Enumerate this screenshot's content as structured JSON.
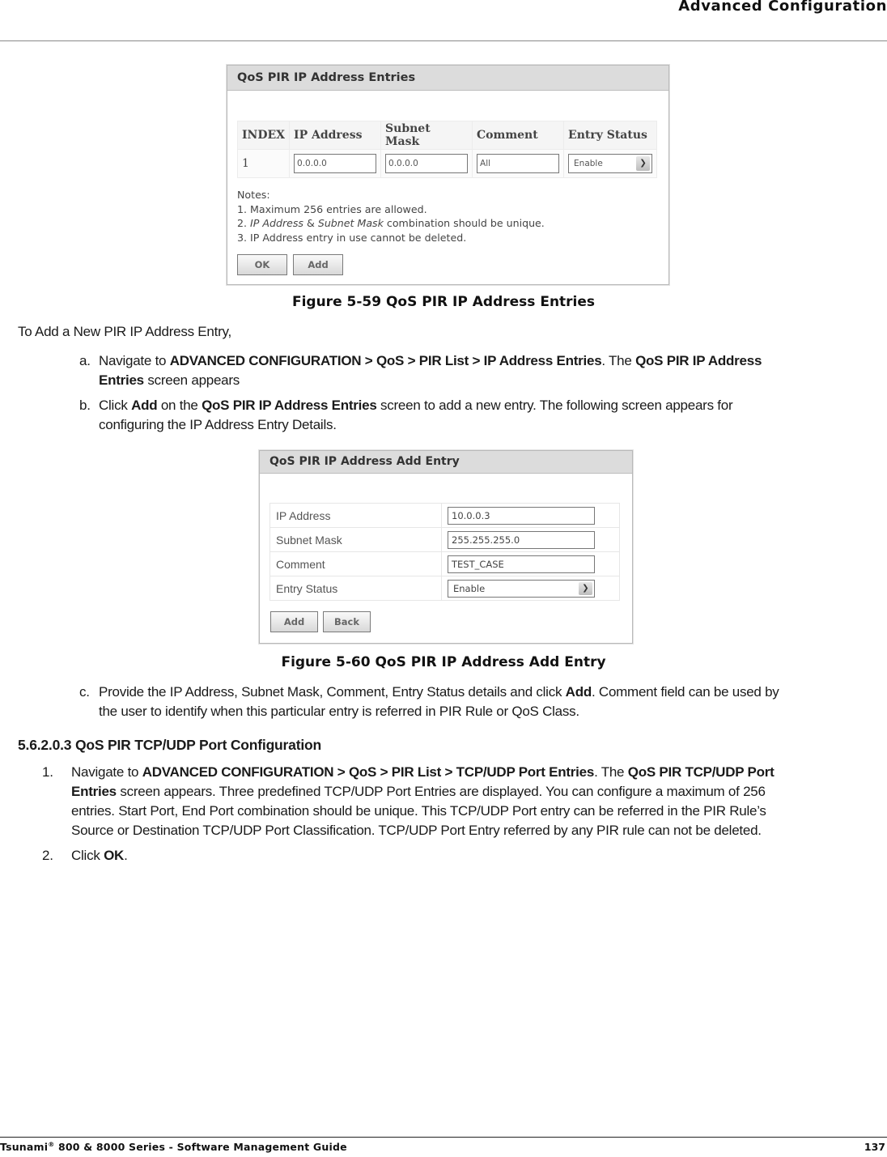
{
  "header": {
    "title": "Advanced Configuration"
  },
  "figure1": {
    "panel_title": "QoS PIR IP Address Entries",
    "columns": [
      "INDEX",
      "IP Address",
      "Subnet Mask",
      "Comment",
      "Entry Status"
    ],
    "rows": [
      {
        "index": "1",
        "ip_address": "0.0.0.0",
        "subnet_mask": "0.0.0.0",
        "comment": "All",
        "entry_status": "Enable"
      }
    ],
    "notes_label": "Notes:",
    "notes": {
      "n1": "1. Maximum 256 entries are allowed.",
      "n2_prefix": "2. ",
      "n2_italic1": "IP Address",
      "n2_amp": " & ",
      "n2_italic2": "Subnet Mask",
      "n2_suffix": " combination should be unique.",
      "n3": "3. IP Address entry in use cannot be deleted."
    },
    "buttons": {
      "ok": "OK",
      "add": "Add"
    },
    "caption": "Figure 5-59 QoS PIR IP Address Entries"
  },
  "intro": "To Add a New PIR IP Address Entry,",
  "steps_alpha": {
    "a": {
      "marker": "a.",
      "t1": "Navigate to ",
      "b1": "ADVANCED CONFIGURATION > QoS > PIR List > IP Address Entries",
      "t2": ". The ",
      "b2": "QoS PIR IP Address",
      "b3": "Entries",
      "t3": " screen appears"
    },
    "b": {
      "marker": "b.",
      "t1": "Click ",
      "b1": "Add",
      "t2": " on the ",
      "b2": "QoS PIR IP Address Entries",
      "t3": " screen to add a new entry. The following screen appears for",
      "t4": "configuring the IP Address Entry Details."
    },
    "c": {
      "marker": "c.",
      "t1": "Provide the IP Address, Subnet Mask, Comment, Entry Status details and click ",
      "b1": "Add",
      "t2": ". Comment field can be used by",
      "t3": "the user to identify when this particular entry is referred in PIR Rule or QoS Class."
    }
  },
  "figure2": {
    "panel_title": "QoS PIR IP Address Add Entry",
    "fields": [
      {
        "label": "IP Address",
        "value": "10.0.0.3"
      },
      {
        "label": "Subnet Mask",
        "value": "255.255.255.0"
      },
      {
        "label": "Comment",
        "value": "TEST_CASE"
      },
      {
        "label": "Entry Status",
        "value": "Enable"
      }
    ],
    "buttons": {
      "add": "Add",
      "back": "Back"
    },
    "caption": "Figure 5-60 QoS PIR IP Address Add Entry"
  },
  "section": {
    "heading": "5.6.2.0.3 QoS PIR TCP/UDP Port Configuration",
    "steps": {
      "s1": {
        "marker": "1.",
        "t1": "Navigate to ",
        "b1": "ADVANCED CONFIGURATION > QoS > PIR List > TCP/UDP Port Entries",
        "t2": ". The ",
        "b2": "QoS PIR TCP/UDP Port",
        "b3": "Entries",
        "t3": " screen appears. Three predefined TCP/UDP Port Entries are displayed. You can configure a maximum of 256",
        "l3": "entries. Start Port, End Port combination should be unique. This TCP/UDP Port entry can be referred in the PIR Rule’s",
        "l4": "Source or Destination TCP/UDP Port Classification. TCP/UDP Port Entry referred by any PIR rule can not be deleted."
      },
      "s2": {
        "marker": "2.",
        "t1": "Click ",
        "b1": "OK",
        "t2": "."
      }
    }
  },
  "footer": {
    "product": "Tsunami",
    "reg": "®",
    "rest": " 800 & 8000 Series - Software Management Guide",
    "page_number": "137"
  }
}
